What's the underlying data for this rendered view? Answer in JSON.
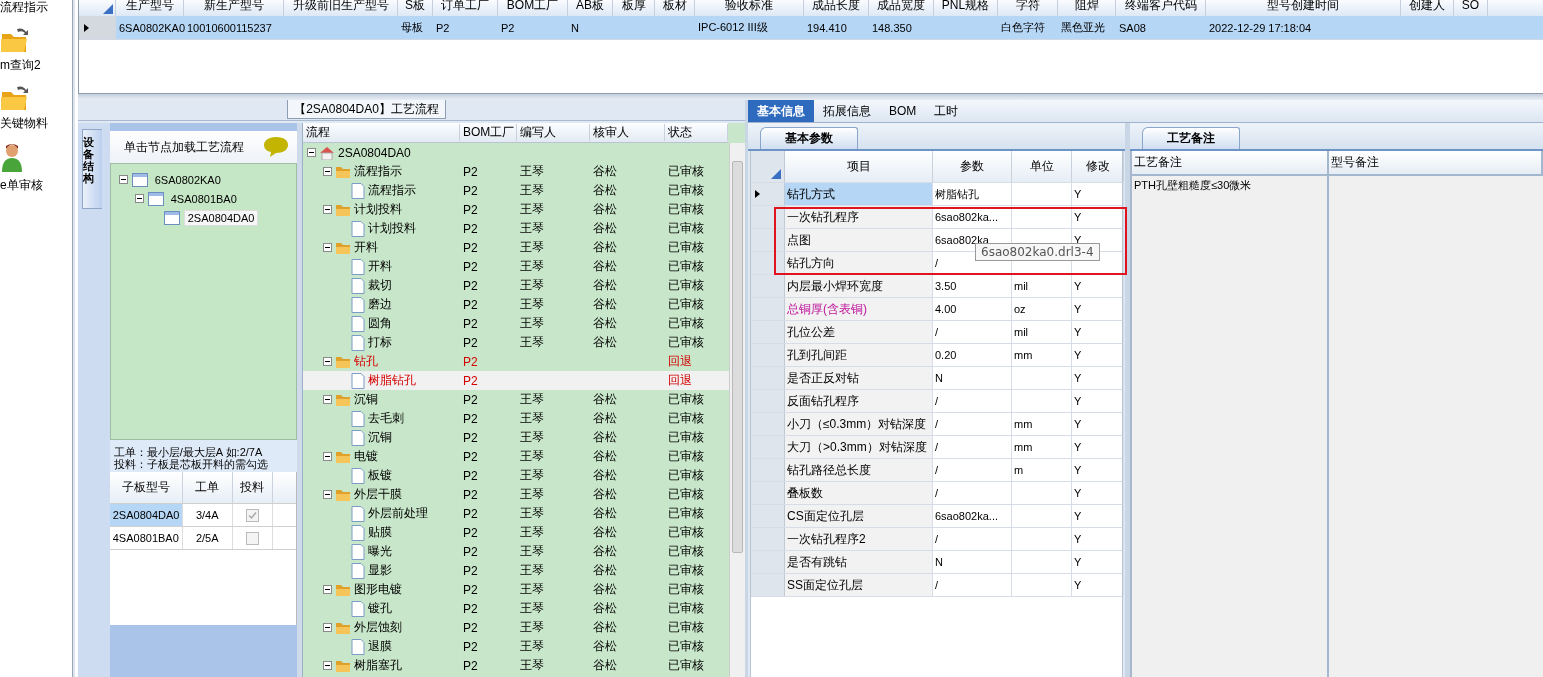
{
  "nav": [
    {
      "kind": "label",
      "label": "流程指示"
    },
    {
      "kind": "folder",
      "label": "m查询2"
    },
    {
      "kind": "folder",
      "label": "关键物料"
    },
    {
      "kind": "person",
      "label": "e单审核"
    }
  ],
  "model_grid": {
    "row_selected": true,
    "columns": [
      {
        "label": "生产型号",
        "value": "6SA0802KA0"
      },
      {
        "label": "新生产型号",
        "value": "10010600115237"
      },
      {
        "label": "升级前旧生产型号"
      },
      {
        "label": "S板",
        "value": "母板"
      },
      {
        "label": "订单工厂",
        "value": "P2"
      },
      {
        "label": "BOM工厂",
        "value": "P2"
      },
      {
        "label": "AB板",
        "value": "N"
      },
      {
        "label": "板厚"
      },
      {
        "label": "板材"
      },
      {
        "label": "验收标准",
        "value": "IPC-6012 III级"
      },
      {
        "label": "成品长度",
        "value": "194.410"
      },
      {
        "label": "成品宽度",
        "value": "148.350"
      },
      {
        "label": "PNL规格"
      },
      {
        "label": "字符",
        "value": "白色字符"
      },
      {
        "label": "阻焊",
        "value": "黑色亚光"
      },
      {
        "label": "终端客户代码",
        "value": "SA08"
      },
      {
        "label": "型号创建时间",
        "value": "2022-12-29 17:18:04"
      },
      {
        "label": "创建人"
      },
      {
        "label": "SO"
      }
    ]
  },
  "flow_caption": "【2SA0804DA0】工艺流程",
  "side_tab": {
    "label": "设备结构",
    "selected": true
  },
  "device_tree": {
    "header": "单击节点加载工艺流程",
    "nodes": [
      {
        "name": "6SA0802KA0",
        "expanded": true,
        "selected": false,
        "children": [
          {
            "name": "4SA0801BA0",
            "expanded": true,
            "selected": false,
            "children": [
              {
                "name": "2SA0804DA0",
                "selected": true
              }
            ]
          }
        ]
      }
    ]
  },
  "notes": [
    "工单：最小层/最大层A 如:2/7A",
    "投料：子板是芯板开料的需勾选"
  ],
  "sub_boards": {
    "columns": [
      "子板型号",
      "工单",
      "投料"
    ],
    "rows": [
      {
        "board": "2SA0804DA0",
        "order": "3/4A",
        "feed": true,
        "selected": true
      },
      {
        "board": "4SA0801BA0",
        "order": "2/5A",
        "feed": false,
        "selected": false
      }
    ]
  },
  "process_tree": {
    "columns": [
      "流程",
      "BOM工厂",
      "编写人",
      "核审人",
      "状态"
    ],
    "root": {
      "name": "2SA0804DA0",
      "expanded": true,
      "selected": false,
      "children": [
        {
          "name": "流程指示",
          "factory": "P2",
          "writer": "王琴",
          "reviewer": "谷松",
          "status": "已审核",
          "rejected": false,
          "expanded": true,
          "selected": false,
          "children": [
            {
              "name": "流程指示",
              "factory": "P2",
              "writer": "王琴",
              "reviewer": "谷松",
              "status": "已审核",
              "rejected": false,
              "selected": false
            }
          ]
        },
        {
          "name": "计划投料",
          "factory": "P2",
          "writer": "王琴",
          "reviewer": "谷松",
          "status": "已审核",
          "rejected": false,
          "expanded": true,
          "selected": false,
          "children": [
            {
              "name": "计划投料",
              "factory": "P2",
              "writer": "王琴",
              "reviewer": "谷松",
              "status": "已审核",
              "rejected": false,
              "selected": false
            }
          ]
        },
        {
          "name": "开料",
          "factory": "P2",
          "writer": "王琴",
          "reviewer": "谷松",
          "status": "已审核",
          "rejected": false,
          "expanded": true,
          "selected": false,
          "children": [
            {
              "name": "开料",
              "factory": "P2",
              "writer": "王琴",
              "reviewer": "谷松",
              "status": "已审核",
              "rejected": false,
              "selected": false
            },
            {
              "name": "裁切",
              "factory": "P2",
              "writer": "王琴",
              "reviewer": "谷松",
              "status": "已审核",
              "rejected": false,
              "selected": false
            },
            {
              "name": "磨边",
              "factory": "P2",
              "writer": "王琴",
              "reviewer": "谷松",
              "status": "已审核",
              "rejected": false,
              "selected": false
            },
            {
              "name": "圆角",
              "factory": "P2",
              "writer": "王琴",
              "reviewer": "谷松",
              "status": "已审核",
              "rejected": false,
              "selected": false
            },
            {
              "name": "打标",
              "factory": "P2",
              "writer": "王琴",
              "reviewer": "谷松",
              "status": "已审核",
              "rejected": false,
              "selected": false
            }
          ]
        },
        {
          "name": "钻孔",
          "factory": "P2",
          "status": "回退",
          "rejected": true,
          "expanded": true,
          "selected": false,
          "children": [
            {
              "name": "树脂钻孔",
              "factory": "P2",
              "status": "回退",
              "rejected": true,
              "selected": true
            }
          ]
        },
        {
          "name": "沉铜",
          "factory": "P2",
          "writer": "王琴",
          "reviewer": "谷松",
          "status": "已审核",
          "rejected": false,
          "expanded": true,
          "selected": false,
          "children": [
            {
              "name": "去毛刺",
              "factory": "P2",
              "writer": "王琴",
              "reviewer": "谷松",
              "status": "已审核",
              "rejected": false,
              "selected": false
            },
            {
              "name": "沉铜",
              "factory": "P2",
              "writer": "王琴",
              "reviewer": "谷松",
              "status": "已审核",
              "rejected": false,
              "selected": false
            }
          ]
        },
        {
          "name": "电镀",
          "factory": "P2",
          "writer": "王琴",
          "reviewer": "谷松",
          "status": "已审核",
          "rejected": false,
          "expanded": true,
          "selected": false,
          "children": [
            {
              "name": "板镀",
              "factory": "P2",
              "writer": "王琴",
              "reviewer": "谷松",
              "status": "已审核",
              "rejected": false,
              "selected": false
            }
          ]
        },
        {
          "name": "外层干膜",
          "factory": "P2",
          "writer": "王琴",
          "reviewer": "谷松",
          "status": "已审核",
          "rejected": false,
          "expanded": true,
          "selected": false,
          "children": [
            {
              "name": "外层前处理",
              "factory": "P2",
              "writer": "王琴",
              "reviewer": "谷松",
              "status": "已审核",
              "rejected": false,
              "selected": false
            },
            {
              "name": "贴膜",
              "factory": "P2",
              "writer": "王琴",
              "reviewer": "谷松",
              "status": "已审核",
              "rejected": false,
              "selected": false
            },
            {
              "name": "曝光",
              "factory": "P2",
              "writer": "王琴",
              "reviewer": "谷松",
              "status": "已审核",
              "rejected": false,
              "selected": false
            },
            {
              "name": "显影",
              "factory": "P2",
              "writer": "王琴",
              "reviewer": "谷松",
              "status": "已审核",
              "rejected": false,
              "selected": false
            }
          ]
        },
        {
          "name": "图形电镀",
          "factory": "P2",
          "writer": "王琴",
          "reviewer": "谷松",
          "status": "已审核",
          "rejected": false,
          "expanded": true,
          "selected": false,
          "children": [
            {
              "name": "镀孔",
              "factory": "P2",
              "writer": "王琴",
              "reviewer": "谷松",
              "status": "已审核",
              "rejected": false,
              "selected": false
            }
          ]
        },
        {
          "name": "外层蚀刻",
          "factory": "P2",
          "writer": "王琴",
          "reviewer": "谷松",
          "status": "已审核",
          "rejected": false,
          "expanded": true,
          "selected": false,
          "children": [
            {
              "name": "退膜",
              "factory": "P2",
              "writer": "王琴",
              "reviewer": "谷松",
              "status": "已审核",
              "rejected": false,
              "selected": false
            }
          ]
        },
        {
          "name": "树脂塞孔",
          "factory": "P2",
          "writer": "王琴",
          "reviewer": "谷松",
          "status": "已审核",
          "rejected": false,
          "expanded": true,
          "selected": false
        }
      ]
    }
  },
  "detail_tabs": [
    {
      "label": "基本信息",
      "selected": true
    },
    {
      "label": "拓展信息",
      "selected": false
    },
    {
      "label": "BOM",
      "selected": false
    },
    {
      "label": "工时",
      "selected": false
    }
  ],
  "params": {
    "tab": "基本参数",
    "columns": [
      "项目",
      "参数",
      "单位",
      "修改"
    ],
    "rows": [
      {
        "item": "钻孔方式",
        "value": "树脂钻孔",
        "modify": "Y",
        "selected": true,
        "flagged": false
      },
      {
        "item": "一次钻孔程序",
        "value": "6sao802ka...",
        "modify": "Y",
        "selected": false,
        "flagged": false
      },
      {
        "item": "点图",
        "value": "6sao802ka",
        "modify": "Y",
        "selected": false,
        "flagged": false
      },
      {
        "item": "钻孔方向",
        "value": "/",
        "selected": false,
        "flagged": false
      },
      {
        "item": "内层最小焊环宽度",
        "value": "3.50",
        "unit": "mil",
        "modify": "Y",
        "selected": false,
        "flagged": false
      },
      {
        "item": "总铜厚(含表铜)",
        "value": "4.00",
        "unit": "oz",
        "modify": "Y",
        "selected": false,
        "flagged": true
      },
      {
        "item": "孔位公差",
        "value": "/",
        "unit": "mil",
        "modify": "Y",
        "selected": false,
        "flagged": false
      },
      {
        "item": "孔到孔间距",
        "value": "0.20",
        "unit": "mm",
        "modify": "Y",
        "selected": false,
        "flagged": false
      },
      {
        "item": "是否正反对钻",
        "value": "N",
        "modify": "Y",
        "selected": false,
        "flagged": false
      },
      {
        "item": "反面钻孔程序",
        "value": "/",
        "modify": "Y",
        "selected": false,
        "flagged": false
      },
      {
        "item": "小刀（≤0.3mm）对钻深度",
        "value": "/",
        "unit": "mm",
        "modify": "Y",
        "selected": false,
        "flagged": false
      },
      {
        "item": "大刀（>0.3mm）对钻深度",
        "value": "/",
        "unit": "mm",
        "modify": "Y",
        "selected": false,
        "flagged": false
      },
      {
        "item": "钻孔路径总长度",
        "value": "/",
        "unit": "m",
        "modify": "Y",
        "selected": false,
        "flagged": false
      },
      {
        "item": "叠板数",
        "value": "/",
        "modify": "Y",
        "selected": false,
        "flagged": false
      },
      {
        "item": "CS面定位孔层",
        "value": "6sao802ka...",
        "modify": "Y",
        "selected": false,
        "flagged": false
      },
      {
        "item": "一次钻孔程序2",
        "value": "/",
        "modify": "Y",
        "selected": false,
        "flagged": false
      },
      {
        "item": "是否有跳钻",
        "value": "N",
        "modify": "Y",
        "selected": false,
        "flagged": false
      },
      {
        "item": "SS面定位孔层",
        "value": "/",
        "modify": "Y",
        "selected": false,
        "flagged": false
      }
    ],
    "tooltip": "6sao802ka0.drl3-4"
  },
  "remarks": {
    "tab": "工艺备注",
    "columns": [
      "工艺备注",
      "型号备注"
    ],
    "process_note": "PTH孔壁粗糙度≤30微米"
  }
}
